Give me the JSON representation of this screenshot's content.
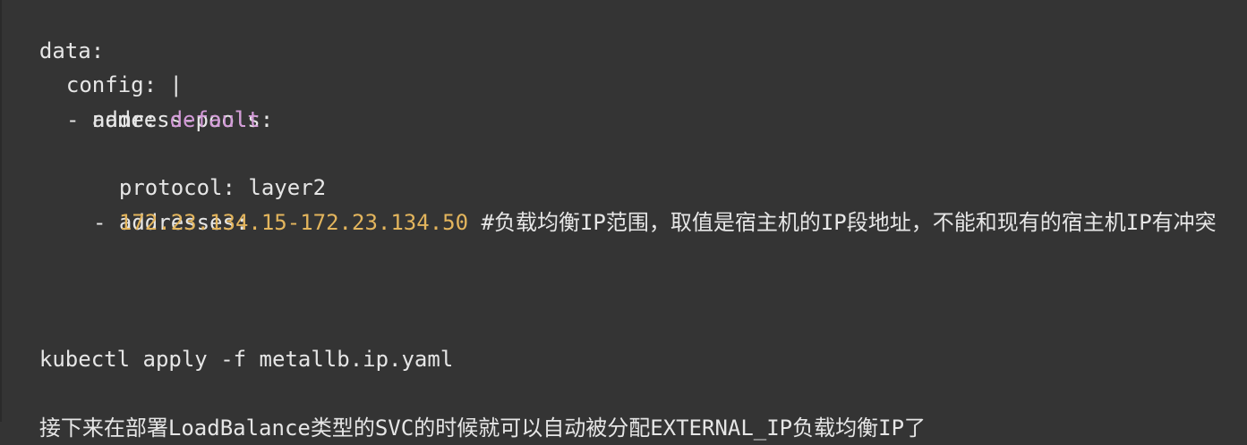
{
  "colors": {
    "background": "#343434",
    "text": "#e6e6e6",
    "string": "#d39ad8",
    "number": "#e3b55d"
  },
  "yaml": {
    "data_key": "data:",
    "config_key": "config: |",
    "address_pools_key": "address-pools:",
    "name_prefix": "- name: ",
    "name_value": "default",
    "protocol_line": "protocol: layer2",
    "addresses_key": "addresses:",
    "address_prefix": "- ",
    "address_value": "172.23.134.15-172.23.134.50",
    "address_comment": " #负载均衡IP范围，取值是宿主机的IP段地址，不能和现有的宿主机IP有冲突"
  },
  "command": {
    "text": "kubectl apply -f metallb.ip.yaml"
  },
  "note": {
    "text": "接下来在部署LoadBalance类型的SVC的时候就可以自动被分配EXTERNAL_IP负载均衡IP了"
  }
}
